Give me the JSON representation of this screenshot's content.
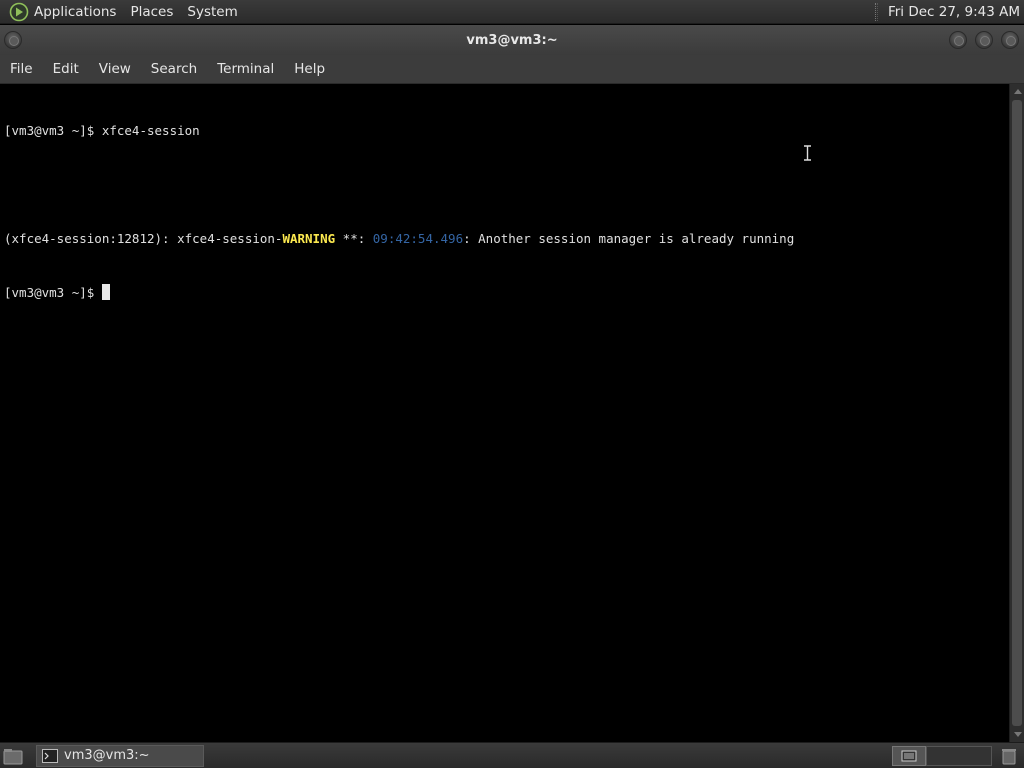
{
  "top_panel": {
    "menus": [
      "Applications",
      "Places",
      "System"
    ],
    "clock": "Fri Dec 27,  9:43 AM"
  },
  "window": {
    "title": "vm3@vm3:~"
  },
  "menubar": {
    "items": [
      "File",
      "Edit",
      "View",
      "Search",
      "Terminal",
      "Help"
    ]
  },
  "terminal": {
    "line1": "[vm3@vm3 ~]$ xfce4-session",
    "line2_prefix": "(xfce4-session:12812): xfce4-session-",
    "line2_warning": "WARNING",
    "line2_stars": " **: ",
    "line2_timestamp": "09:42:54.496",
    "line2_message": ": Another session manager is already running",
    "line3_prompt": "[vm3@vm3 ~]$ "
  },
  "taskbar": {
    "task_label": "vm3@vm3:~"
  },
  "colors": {
    "warning": "#fce94f",
    "timestamp": "#3465a4",
    "terminal_bg": "#000000",
    "chrome": "#3c3c3c"
  }
}
